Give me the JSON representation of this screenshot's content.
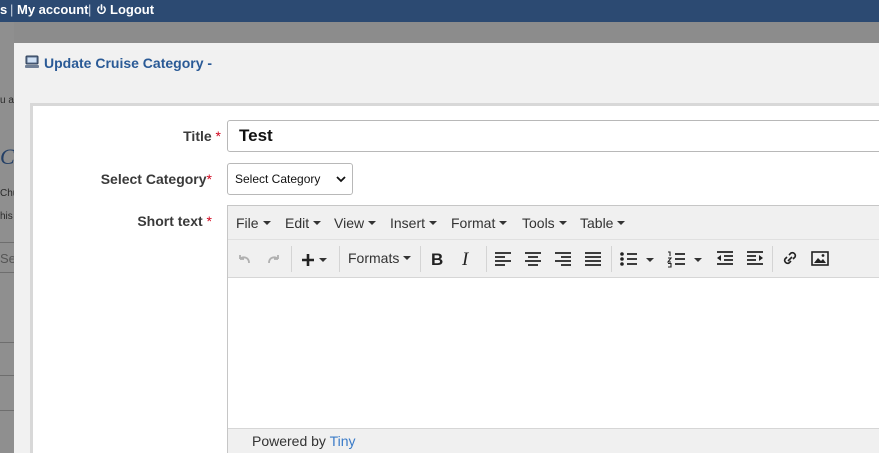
{
  "topbar": {
    "fragment": "s",
    "my_account": "My account",
    "logout": "Logout"
  },
  "background": {
    "frag1": "u an",
    "frag2": "Cr",
    "frag3": "Chú",
    "frag4": "his",
    "frag5": "Se"
  },
  "dialog": {
    "title": "Update Cruise Category -",
    "icon": "computer-icon"
  },
  "form": {
    "title_label": "Title",
    "title_value": "Test",
    "category_label": "Select Category",
    "category_value": "Select Category",
    "short_text_label": "Short text",
    "required_mark": "*"
  },
  "editor": {
    "menu": [
      "File",
      "Edit",
      "View",
      "Insert",
      "Format",
      "Tools",
      "Table"
    ],
    "formats_label": "Formats",
    "powered_by": "Powered by",
    "powered_link": "Tiny",
    "toolbar_icons": [
      "undo-icon",
      "redo-icon",
      "insert-plus-icon",
      "bold-icon",
      "italic-icon",
      "align-left-icon",
      "align-center-icon",
      "align-right-icon",
      "align-justify-icon",
      "bullet-list-icon",
      "numbered-list-icon",
      "outdent-icon",
      "indent-icon",
      "link-icon",
      "image-icon"
    ]
  },
  "colors": {
    "topbar": "#2c4a72",
    "dialog_title": "#2a5a96",
    "required": "#d0021b",
    "link": "#3a7bc8"
  }
}
